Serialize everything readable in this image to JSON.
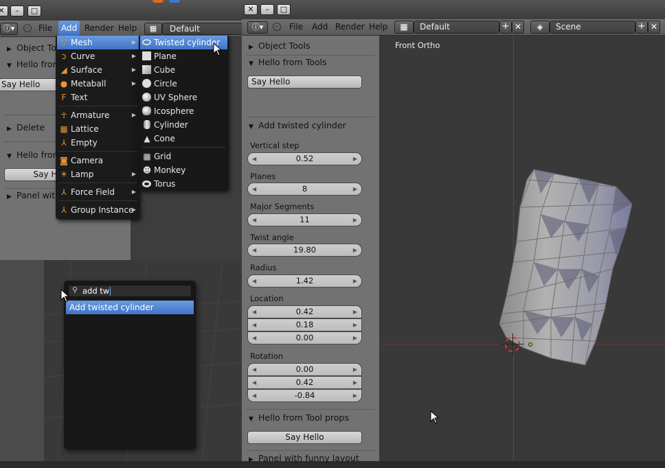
{
  "left_window": {
    "menu": {
      "file": "File",
      "add": "Add",
      "render": "Render",
      "help": "Help",
      "layout": "Default"
    },
    "panels": {
      "object_tools": "Object Tools",
      "hello_from_tools": "Hello from To",
      "say_hello": "Say Hello",
      "delete": "Delete",
      "hello_from_tool2": "Hello from To",
      "say_hello2": "Say H",
      "panel_funny": "Panel with fu"
    }
  },
  "add_menu": {
    "items": [
      {
        "label": "Mesh",
        "icon": "mesh-icon"
      },
      {
        "label": "Curve",
        "icon": "curve-icon"
      },
      {
        "label": "Surface",
        "icon": "surface-icon"
      },
      {
        "label": "Metaball",
        "icon": "metaball-icon"
      },
      {
        "label": "Text",
        "icon": "text-icon"
      },
      {
        "label": "Armature",
        "icon": "armature-icon"
      },
      {
        "label": "Lattice",
        "icon": "lattice-icon"
      },
      {
        "label": "Empty",
        "icon": "empty-icon"
      },
      {
        "label": "Camera",
        "icon": "camera-icon"
      },
      {
        "label": "Lamp",
        "icon": "lamp-icon"
      },
      {
        "label": "Force Field",
        "icon": "forcefield-icon"
      },
      {
        "label": "Group Instance",
        "icon": "group-icon"
      }
    ]
  },
  "mesh_menu": {
    "items": [
      {
        "label": "Twisted cylinder"
      },
      {
        "label": "Plane"
      },
      {
        "label": "Cube"
      },
      {
        "label": "Circle"
      },
      {
        "label": "UV Sphere"
      },
      {
        "label": "Icosphere"
      },
      {
        "label": "Cylinder"
      },
      {
        "label": "Cone"
      },
      {
        "label": "Grid"
      },
      {
        "label": "Monkey"
      },
      {
        "label": "Torus"
      }
    ]
  },
  "search_popup": {
    "query": "add tw",
    "result": "Add twisted cylinder"
  },
  "right_window": {
    "menu": {
      "file": "File",
      "add": "Add",
      "render": "Render",
      "help": "Help",
      "layout": "Default",
      "scene": "Scene"
    },
    "viewport_label": "Front Ortho",
    "panels": {
      "object_tools": "Object Tools",
      "hello_from_tools": "Hello from Tools",
      "say_hello": "Say Hello",
      "add_twisted": "Add twisted cylinder",
      "hello_props": "Hello from Tool props",
      "say_hello_props": "Say Hello",
      "panel_funny": "Panel with funny layout"
    },
    "operator_props": {
      "vertical_step_label": "Vertical step",
      "vertical_step": "0.52",
      "planes_label": "Planes",
      "planes": "8",
      "major_segments_label": "Major Segments",
      "major_segments": "11",
      "twist_angle_label": "Twist angle",
      "twist_angle": "19.80",
      "radius_label": "Radius",
      "radius": "1.42",
      "location_label": "Location",
      "location": [
        "0.42",
        "0.18",
        "0.00"
      ],
      "rotation_label": "Rotation",
      "rotation": [
        "0.00",
        "0.42",
        "-0.84"
      ]
    }
  }
}
